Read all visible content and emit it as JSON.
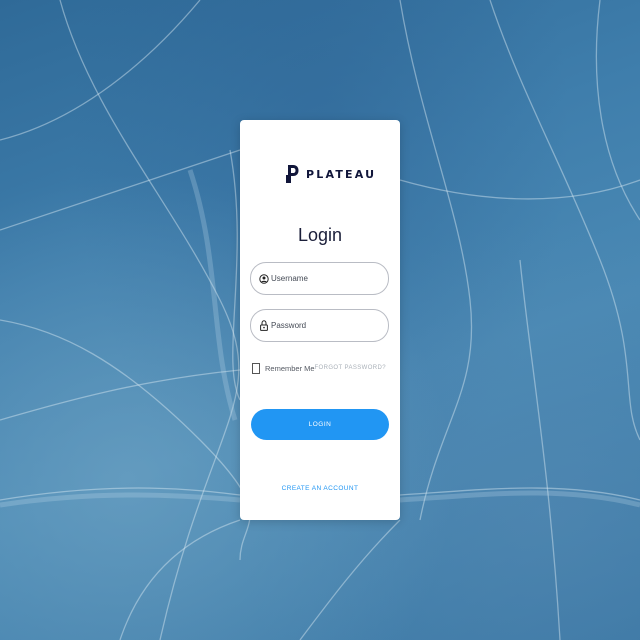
{
  "brand": {
    "name": "PLATEAU",
    "color": "#11163a"
  },
  "login": {
    "title": "Login",
    "username_placeholder": "Username",
    "password_placeholder": "Password",
    "remember_label": "Remember Me",
    "forgot_label": "FORGOT PASSWORD?",
    "login_label": "LOGIN",
    "create_label": "CREATE AN ACCOUNT"
  },
  "colors": {
    "accent": "#2196f3",
    "background": "#3f7eac",
    "card": "#ffffff"
  },
  "icons": {
    "username": "user-circle-icon",
    "password": "lock-icon",
    "logo": "plateau-logo-icon"
  }
}
